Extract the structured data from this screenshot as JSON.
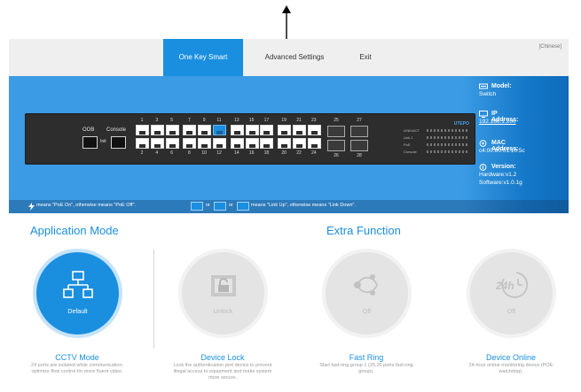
{
  "nav": {
    "tabs": [
      "One Key Smart",
      "Advanced Settings",
      "Exit"
    ],
    "active_tab": "One Key Smart",
    "language_link": "[Chinese]"
  },
  "device_panel": {
    "oob_label": "OOB",
    "console_label": "Console",
    "init_label": "Init",
    "top_port_numbers": [
      "1",
      "3",
      "5",
      "7",
      "9",
      "11",
      "13",
      "15",
      "17",
      "19",
      "21",
      "23",
      "25",
      "27"
    ],
    "bottom_port_numbers": [
      "2",
      "4",
      "6",
      "8",
      "10",
      "12",
      "14",
      "16",
      "18",
      "20",
      "22",
      "24",
      "26",
      "28"
    ],
    "link_up_ports": [
      "11"
    ],
    "brand": "UTEPO",
    "led_labels": [
      "LINK/ACT",
      "Link 1",
      "PoE",
      "Console"
    ]
  },
  "device_info": {
    "model_label": "Model:",
    "model_value": "Switch",
    "ip_label": "IP Address:",
    "ip_value": "192.168.1.200",
    "mac_label": "MAC Address:",
    "mac_value": "c4:00:80:01:10:5c",
    "version_label": "Version:",
    "hardware_value": "Hardware:v1.2",
    "software_value": "Software:v1.0.1g"
  },
  "legend": {
    "poe_text": "means \"PoE On\", otherwise means \"PoE Off\".",
    "or_text": "or",
    "or_text_2": "or",
    "link_text": "means \"Link Up\", otherwise means \"Link Down\"."
  },
  "sections": {
    "application_mode": "Application Mode",
    "extra_function": "Extra Function"
  },
  "features": [
    {
      "circle_label": "Default",
      "title": "CCTV Mode",
      "desc": "24 ports are isolated while communication; optimize flow control for more fluent video.",
      "state": "on",
      "icon": "network-topology-icon"
    },
    {
      "circle_label": "Unlock",
      "title": "Device Lock",
      "desc": "Lock the authentication port device to prevent illegal access to equipment and make system more secure.",
      "state": "off",
      "icon": "lock-icon"
    },
    {
      "circle_label": "Off",
      "title": "Fast Ring",
      "desc": "Start fast-ring group 1 (25,26 ports fast-ring group).",
      "state": "off",
      "icon": "ring-nodes-icon"
    },
    {
      "circle_label": "Off",
      "title": "Device Online",
      "desc": "24-hour online monitoring device (POE watchdog).",
      "state": "off",
      "icon": "clock-24h-icon"
    }
  ],
  "colors": {
    "accent": "#1a8fe0",
    "band": "#3b9be4",
    "nav_bg": "#efefef",
    "disabled": "#e4e4e4"
  }
}
